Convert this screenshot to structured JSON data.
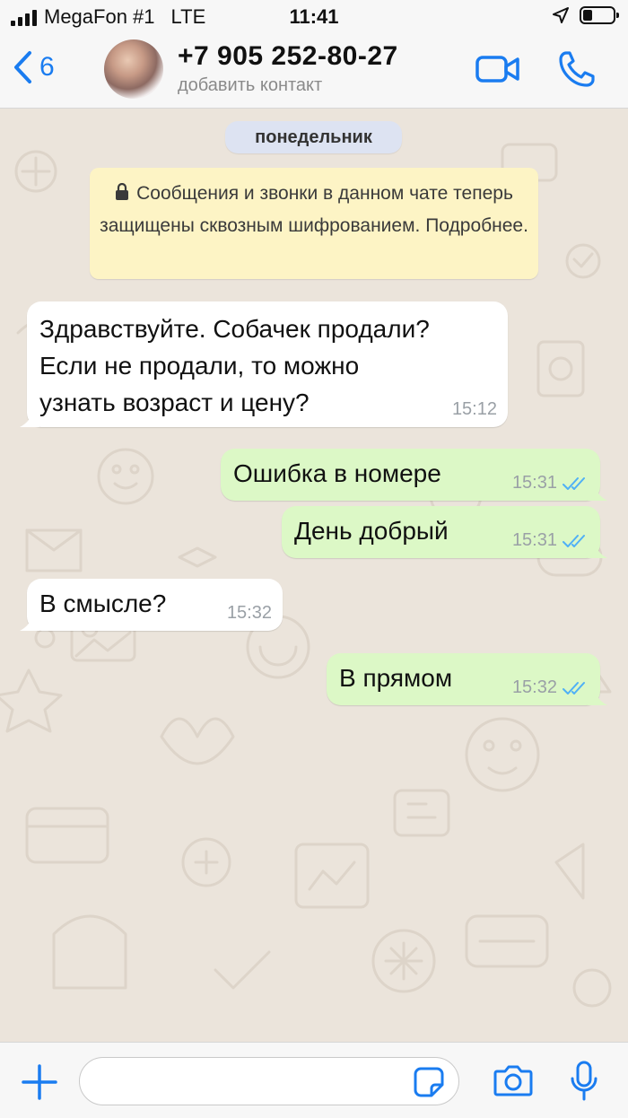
{
  "status_bar": {
    "carrier": "MegaFon #1",
    "network": "LTE",
    "time": "11:41"
  },
  "header": {
    "back_count": "6",
    "contact_name": "+7 905 252-80-27",
    "contact_sub": "добавить контакт",
    "accent_color": "#1a7cf0"
  },
  "chat": {
    "day_label": "понедельник",
    "encryption_notice": "Сообщения и звонки в данном чате теперь защищены сквозным шифрованием. Подробнее.",
    "messages": [
      {
        "direction": "in",
        "text": "Здравствуйте. Собачек продали?\nЕсли не продали, то можно\nузнать возраст и цену?",
        "time": "15:12"
      },
      {
        "direction": "out",
        "text": "Ошибка в номере",
        "time": "15:31",
        "status": "read"
      },
      {
        "direction": "out",
        "text": "День добрый",
        "time": "15:31",
        "status": "read"
      },
      {
        "direction": "in",
        "text": "В смысле?",
        "time": "15:32"
      },
      {
        "direction": "out",
        "text": "В прямом",
        "time": "15:32",
        "status": "read"
      }
    ]
  },
  "input_bar": {
    "placeholder": "",
    "icons": [
      "plus-icon",
      "sticker-icon",
      "camera-icon",
      "microphone-icon"
    ]
  }
}
